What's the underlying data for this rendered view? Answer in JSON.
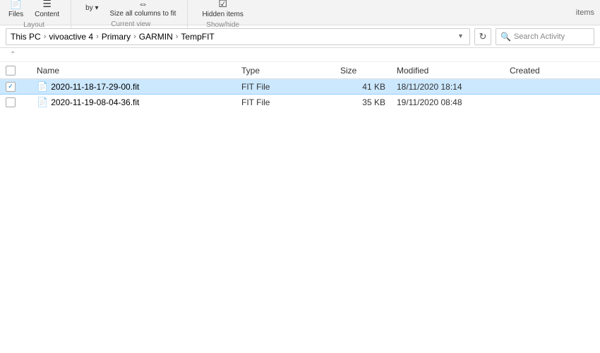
{
  "toolbar": {
    "layout_label": "Layout",
    "current_view_label": "Current view",
    "show_hide_label": "Show/hide",
    "items_label": "items",
    "buttons": [
      {
        "id": "files",
        "label": "Files",
        "icon": "📄"
      },
      {
        "id": "content",
        "label": "Content",
        "icon": "☰"
      }
    ],
    "view_buttons": [
      {
        "id": "by",
        "label": "by ▾"
      },
      {
        "id": "size-all-columns",
        "label": "Size all columns to fit"
      },
      {
        "id": "hidden-items",
        "label": "Hidden items"
      }
    ]
  },
  "address_bar": {
    "breadcrumbs": [
      {
        "label": "This PC"
      },
      {
        "label": "vivoactive 4"
      },
      {
        "label": "Primary"
      },
      {
        "label": "GARMIN"
      },
      {
        "label": "TempFIT"
      }
    ],
    "search_placeholder": "Search Activity"
  },
  "columns": {
    "name": "Name",
    "type": "Type",
    "size": "Size",
    "modified": "Modified",
    "created": "Created"
  },
  "files": [
    {
      "name": "2020-11-18-17-29-00.fit",
      "type": "FIT File",
      "size": "41 KB",
      "modified": "18/11/2020 18:14",
      "created": "",
      "selected": true
    },
    {
      "name": "2020-11-19-08-04-36.fit",
      "type": "FIT File",
      "size": "35 KB",
      "modified": "19/11/2020 08:48",
      "created": "",
      "selected": false
    }
  ]
}
